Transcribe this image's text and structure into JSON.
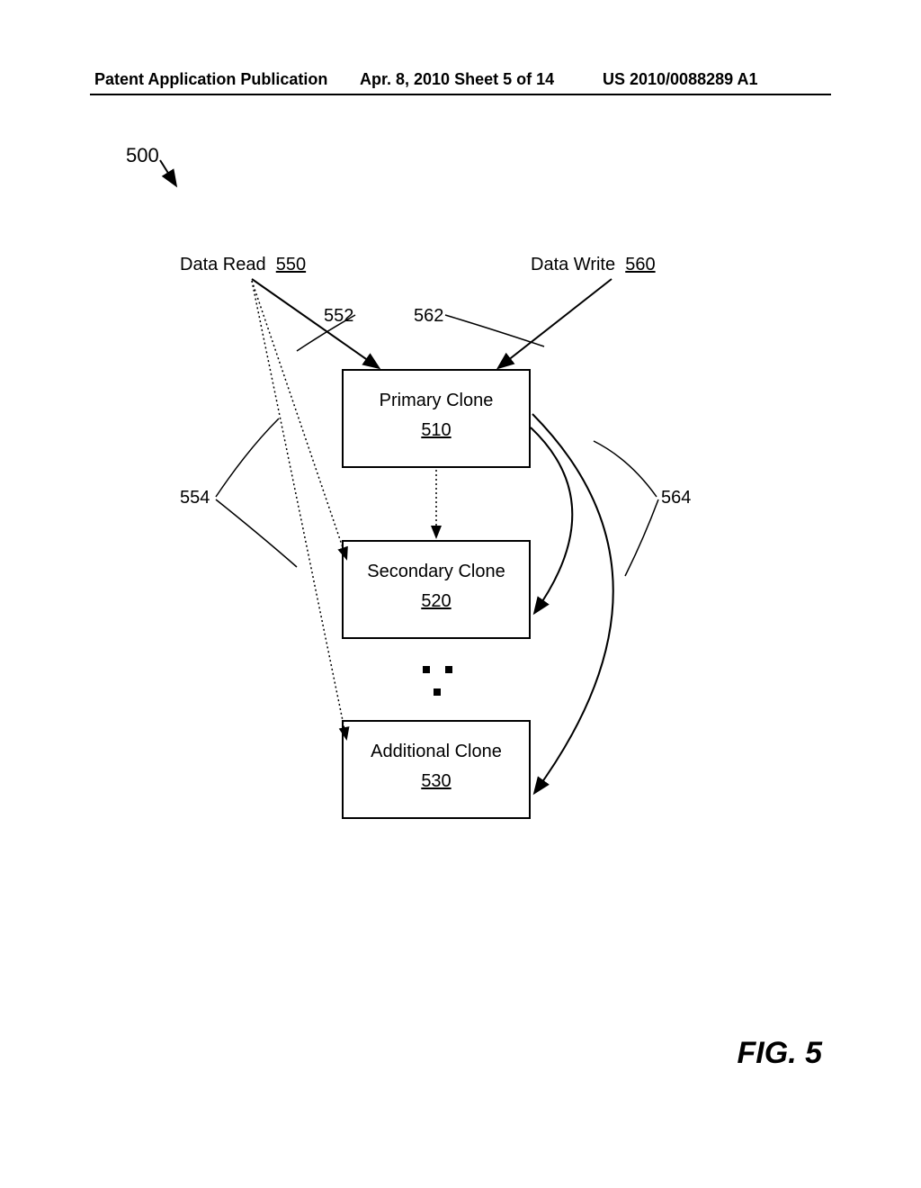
{
  "header": {
    "left": "Patent Application Publication",
    "mid": "Apr. 8, 2010   Sheet 5 of 14",
    "right": "US 2010/0088289 A1"
  },
  "figureRef": "500",
  "dataRead": {
    "label": "Data Read",
    "num": "550"
  },
  "dataWrite": {
    "label": "Data Write",
    "num": "560"
  },
  "arrowRefs": {
    "readToPrimary": "552",
    "writeToPrimary": "562",
    "readFan": "554",
    "writeFan": "564"
  },
  "boxes": {
    "primary": {
      "label": "Primary Clone",
      "num": "510"
    },
    "secondary": {
      "label": "Secondary Clone",
      "num": "520"
    },
    "additional": {
      "label": "Additional Clone",
      "num": "530"
    }
  },
  "caption": "FIG. 5"
}
